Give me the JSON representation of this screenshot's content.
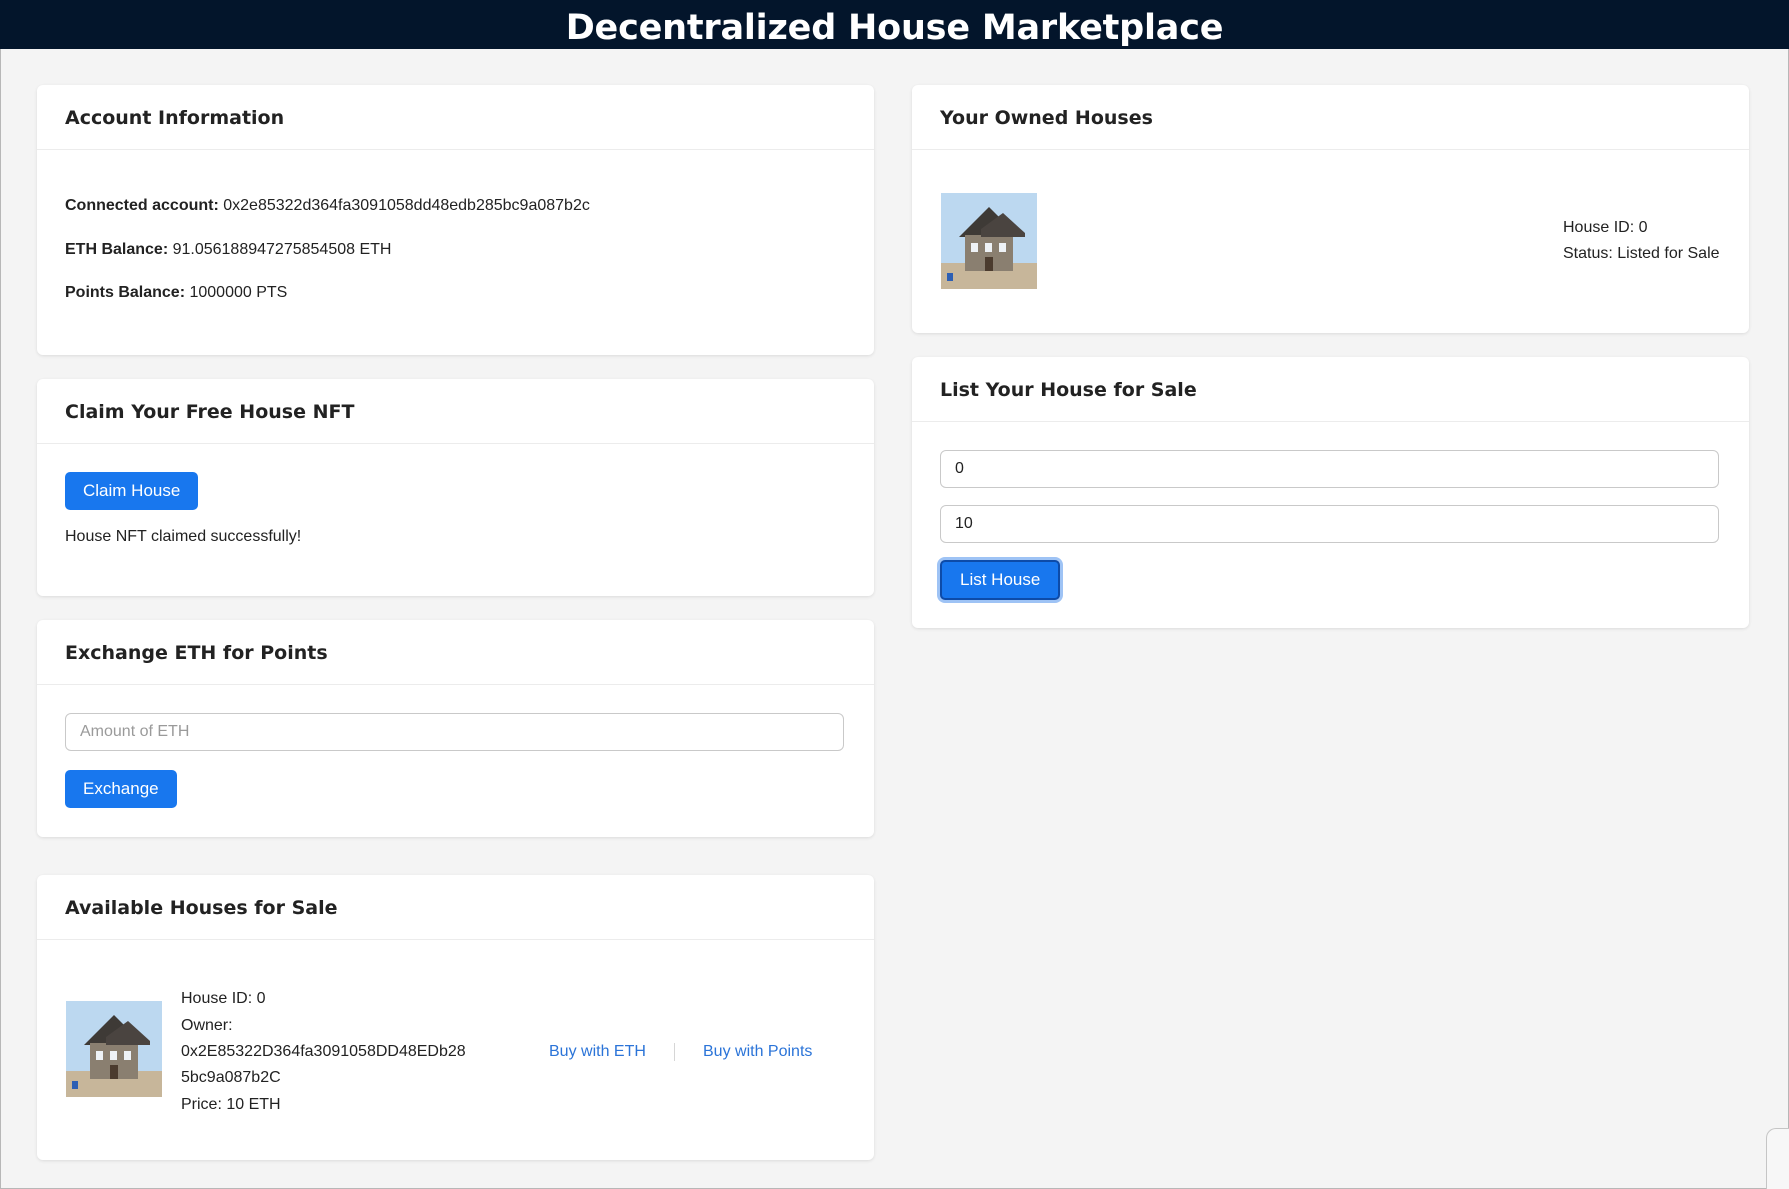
{
  "header": {
    "title": "Decentralized House Marketplace"
  },
  "account": {
    "title": "Account Information",
    "connected_label": "Connected account:",
    "connected_value": "0x2e85322d364fa3091058dd48edb285bc9a087b2c",
    "eth_label": "ETH Balance:",
    "eth_value": "91.056188947275854508 ETH",
    "points_label": "Points Balance:",
    "points_value": "1000000 PTS"
  },
  "claim": {
    "title": "Claim Your Free House NFT",
    "button_label": "Claim House",
    "status": "House NFT claimed successfully!"
  },
  "exchange": {
    "title": "Exchange ETH for Points",
    "placeholder": "Amount of ETH",
    "value": "",
    "button_label": "Exchange"
  },
  "available": {
    "title": "Available Houses for Sale",
    "items": [
      {
        "id_line": "House ID: 0",
        "owner_label": "Owner:",
        "owner_line1": "0x2E85322D364fa3091058DD48EDb28",
        "owner_line2": "5bc9a087b2C",
        "price_line": "Price: 10 ETH",
        "buy_eth_label": "Buy with ETH",
        "buy_points_label": "Buy with Points"
      }
    ]
  },
  "owned": {
    "title": "Your Owned Houses",
    "items": [
      {
        "id_line": "House ID: 0",
        "status_line": "Status: Listed for Sale"
      }
    ]
  },
  "list_sale": {
    "title": "List Your House for Sale",
    "house_id_value": "0",
    "price_value": "10",
    "button_label": "List House"
  },
  "colors": {
    "header_bg": "#03152b",
    "primary_button": "#1877ee",
    "link": "#2b74d8",
    "page_bg": "#f4f4f4"
  }
}
